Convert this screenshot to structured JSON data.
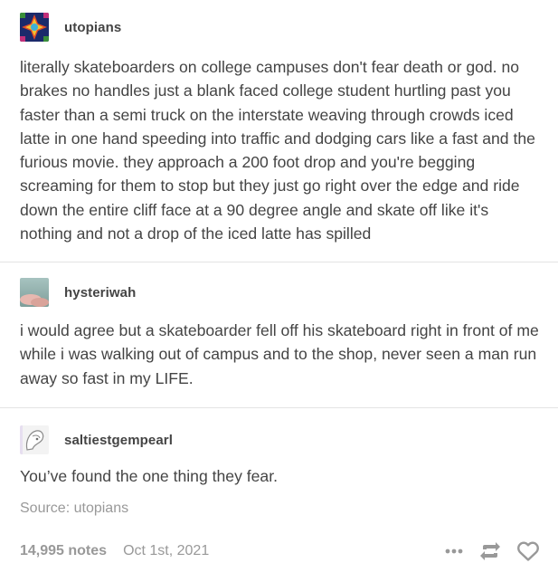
{
  "posts": [
    {
      "username": "utopians",
      "text": "literally skateboarders on college campuses don't fear death or god. no brakes no handles just a blank faced college student hurtling past you faster than a semi truck on the interstate weaving through crowds iced latte in one hand speeding into traffic and dodging cars like a fast and the furious movie. they approach a 200 foot drop and you're begging screaming for them to stop but they just go right over the edge and ride down the entire cliff face at a 90 degree angle and skate off like it's nothing and not a drop of the iced latte has spilled"
    },
    {
      "username": "hysteriwah",
      "text": "i would agree but a skateboarder fell off his skateboard right in front of me while i was walking out of campus and to the shop, never seen a man run away so fast in my LIFE."
    },
    {
      "username": "saltiestgempearl",
      "text": "You’ve found the one thing they fear."
    }
  ],
  "source": {
    "label": "Source:",
    "name": "utopians"
  },
  "footer": {
    "notes": "14,995 notes",
    "date": "Oct 1st, 2021"
  },
  "icons": {
    "more": "more-dots-icon",
    "reblog": "reblog-icon",
    "like": "heart-icon"
  },
  "colors": {
    "text": "#444444",
    "muted": "#999999",
    "divider": "#e4e4e4"
  }
}
